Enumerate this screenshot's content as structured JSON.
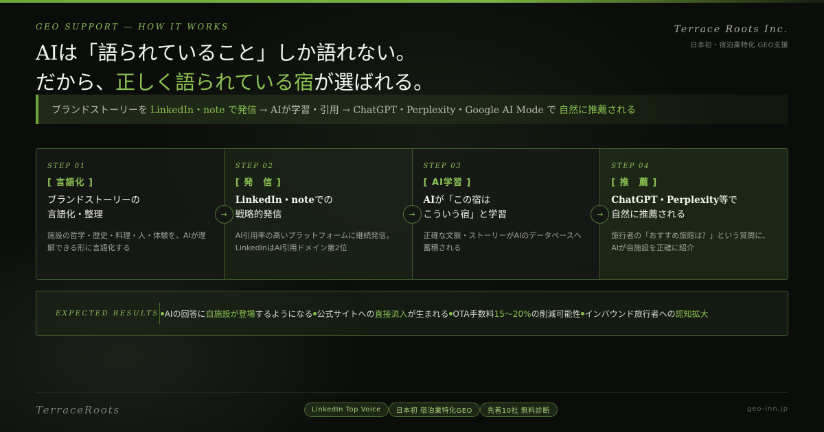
{
  "eyebrow": "GEO SUPPORT — HOW IT WORKS",
  "brand": {
    "name": "Terrace Roots Inc.",
    "subtitle": "日本初・宿泊業特化 GEO支援"
  },
  "headline": {
    "line1": "AIは「語られていること」しか語れない。",
    "line2_prefix": "だから、",
    "line2_accent": "正しく語られている宿",
    "line2_suffix": "が選ばれる。"
  },
  "tagline": {
    "part1": "ブランドストーリーを",
    "accent1": "LinkedIn・note で発信",
    "part2": "→ AIが学習・引用 → ChatGPT・Perplexity・Google AI Mode で",
    "accent2": "自然に推薦される"
  },
  "steps": [
    {
      "no": "STEP 01",
      "tag": "[ 言語化 ]",
      "title_line1": "ブランドストーリーの",
      "title_line2": "言語化・整理",
      "desc_line1": "施設の哲学・歴史・料理・人・体験を、AIが理",
      "desc_line2": "解できる形に言語化する"
    },
    {
      "no": "STEP 02",
      "tag": "[ 発　信 ]",
      "title_bold": "LinkedIn・note",
      "title_rest": "での",
      "title_line2": "戦略的発信",
      "desc_line1": "AI引用率の高いプラットフォームに継続発信。",
      "desc_line2": "LinkedInはAI引用ドメイン第2位"
    },
    {
      "no": "STEP 03",
      "tag": "[ AI学習 ]",
      "title_bold": "AI",
      "title_rest": "が「この宿は",
      "title_line2": "こういう宿」と学習",
      "desc_line1": "正確な文脈・ストーリーがAIのデータベースへ",
      "desc_line2": "蓄積される"
    },
    {
      "no": "STEP 04",
      "tag": "[ 推　薦 ]",
      "title_bold": "ChatGPT・Perplexity",
      "title_rest": "等で",
      "title_line2": "自然に推薦される",
      "desc_line1": "旅行者の「おすすめ旅館は？」という質問に、",
      "desc_line2": "AIが自施設を正確に紹介"
    }
  ],
  "arrow_glyph": "→",
  "results": {
    "label": "EXPECTED RESULTS",
    "items": [
      {
        "pre": "AIの回答に",
        "acc": "自施設が登場",
        "post": "するようになる"
      },
      {
        "pre": "公式サイトへの",
        "acc": "直接流入",
        "post": "が生まれる"
      },
      {
        "pre": "OTA手数料",
        "acc": "15〜20%",
        "post": "の削減可能性"
      },
      {
        "pre": "インバウンド旅行者への",
        "acc": "認知拡大",
        "post": ""
      }
    ]
  },
  "footer": {
    "brand": "TerraceRoots",
    "badges": [
      "LinkedIn Top Voice",
      "日本初 宿泊業特化GEO",
      "先着10社 無料診断"
    ],
    "url": "geo-inn.jp"
  },
  "colors": {
    "accent": "#8cc253",
    "background": "#0b0d0a"
  }
}
